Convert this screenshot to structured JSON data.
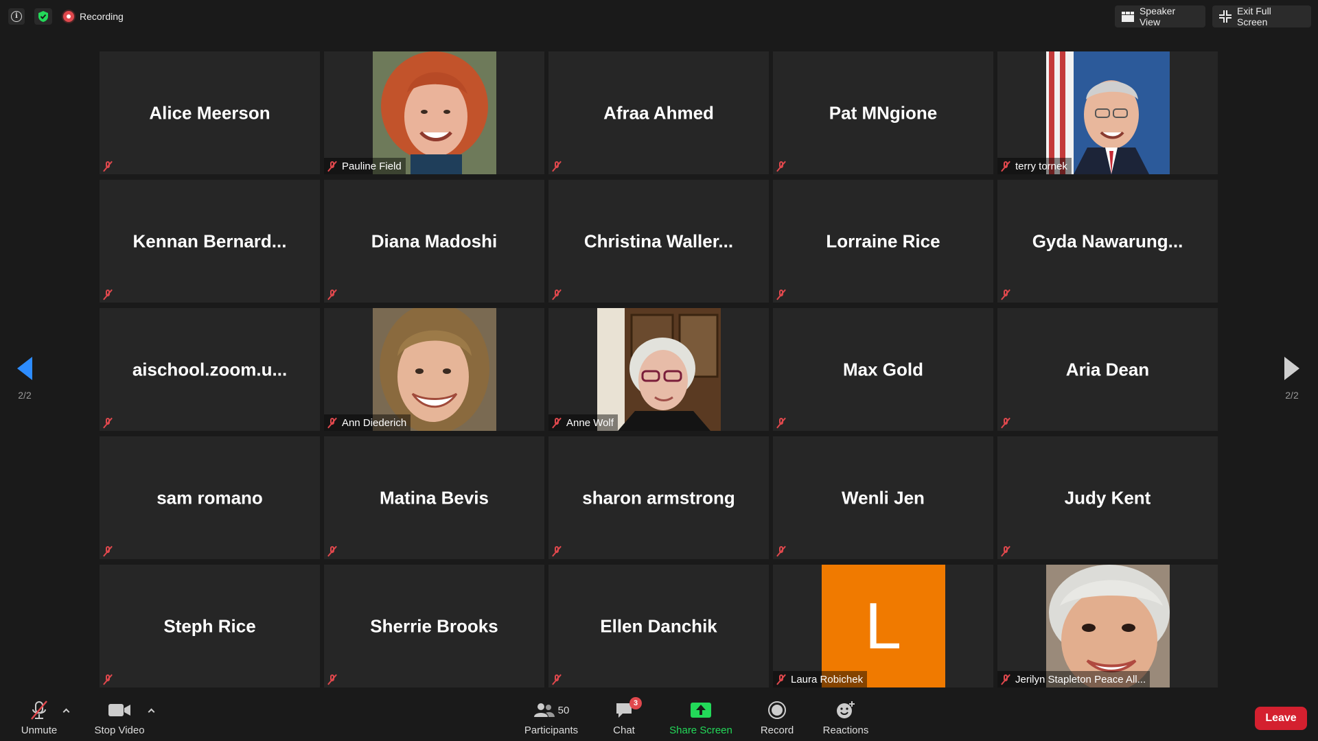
{
  "topbar": {
    "recording_label": "Recording",
    "speaker_view_label": "Speaker View",
    "exit_full_screen_label": "Exit Full Screen"
  },
  "pager": {
    "left_text": "2/2",
    "right_text": "2/2"
  },
  "tiles": [
    {
      "name": "Alice Meerson",
      "footer": "",
      "type": "name"
    },
    {
      "name": "",
      "footer": "Pauline Field",
      "type": "video"
    },
    {
      "name": "Afraa Ahmed",
      "footer": "",
      "type": "name"
    },
    {
      "name": "Pat MNgione",
      "footer": "",
      "type": "name"
    },
    {
      "name": "",
      "footer": "terry tornek",
      "type": "video"
    },
    {
      "name": "Kennan  Bernard...",
      "footer": "",
      "type": "name"
    },
    {
      "name": "Diana Madoshi",
      "footer": "",
      "type": "name"
    },
    {
      "name": "Christina  Waller...",
      "footer": "",
      "type": "name"
    },
    {
      "name": "Lorraine Rice",
      "footer": "",
      "type": "name"
    },
    {
      "name": "Gyda  Nawarung...",
      "footer": "",
      "type": "name"
    },
    {
      "name": "aischool.zoom.u...",
      "footer": "",
      "type": "name"
    },
    {
      "name": "",
      "footer": "Ann Diederich",
      "type": "video"
    },
    {
      "name": "",
      "footer": "Anne Wolf",
      "type": "video"
    },
    {
      "name": "Max Gold",
      "footer": "",
      "type": "name"
    },
    {
      "name": "Aria Dean",
      "footer": "",
      "type": "name"
    },
    {
      "name": "sam romano",
      "footer": "",
      "type": "name"
    },
    {
      "name": "Matina Bevis",
      "footer": "",
      "type": "name"
    },
    {
      "name": "sharon armstrong",
      "footer": "",
      "type": "name"
    },
    {
      "name": "Wenli Jen",
      "footer": "",
      "type": "name"
    },
    {
      "name": "Judy Kent",
      "footer": "",
      "type": "name"
    },
    {
      "name": "Steph Rice",
      "footer": "",
      "type": "name"
    },
    {
      "name": "Sherrie Brooks",
      "footer": "",
      "type": "name"
    },
    {
      "name": "Ellen Danchik",
      "footer": "",
      "type": "name"
    },
    {
      "name": "",
      "footer": "Laura Robichek",
      "type": "avatar",
      "initial": "L"
    },
    {
      "name": "",
      "footer": "Jerilyn Stapleton Peace All...",
      "type": "video"
    }
  ],
  "toolbar": {
    "unmute_label": "Unmute",
    "stop_video_label": "Stop Video",
    "participants_label": "Participants",
    "participants_count": "50",
    "chat_label": "Chat",
    "chat_badge": "3",
    "share_screen_label": "Share Screen",
    "record_label": "Record",
    "reactions_label": "Reactions",
    "leave_label": "Leave"
  },
  "colors": {
    "accent_blue": "#2d8cff",
    "share_green": "#23d959",
    "muted_red": "#e0484d",
    "leave_red": "#d4202f",
    "avatar_orange": "#f07a00"
  }
}
